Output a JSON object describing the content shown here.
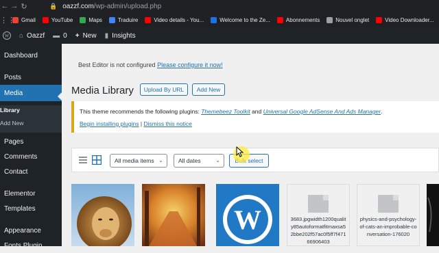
{
  "browser": {
    "url_host": "oazzf.com",
    "url_path": "/wp-admin/upload.php",
    "bookmarks": [
      {
        "label": "Gmail",
        "color": "#ea4335"
      },
      {
        "label": "YouTube",
        "color": "#ff0000"
      },
      {
        "label": "Maps",
        "color": "#34a853"
      },
      {
        "label": "Traduire",
        "color": "#4285f4"
      },
      {
        "label": "Video details - You...",
        "color": "#ff0000"
      },
      {
        "label": "Welcome to the Ze...",
        "color": "#1a73e8"
      },
      {
        "label": "Abonnements",
        "color": "#ff0000"
      },
      {
        "label": "Nouvel onglet",
        "color": "#9aa0a6"
      },
      {
        "label": "Video Downloader...",
        "color": "#ff0000"
      }
    ]
  },
  "adminbar": {
    "site_name": "Oazzf",
    "comments_count": "0",
    "new_label": "New",
    "insights_label": "Insights"
  },
  "sidebar": {
    "items": [
      {
        "label": "Dashboard"
      },
      {
        "label": "Posts"
      },
      {
        "label": "Media"
      },
      {
        "label": "Pages"
      },
      {
        "label": "Comments"
      },
      {
        "label": "Contact"
      },
      {
        "label": "Elementor"
      },
      {
        "label": "Templates"
      },
      {
        "label": "Appearance"
      },
      {
        "label": "Fonts Plugin"
      }
    ],
    "submenu": [
      {
        "label": "Library"
      },
      {
        "label": "Add New"
      }
    ]
  },
  "main": {
    "best_editor_text": "Best Editor is not configured",
    "best_editor_link": "Please configure it now!",
    "title": "Media Library",
    "upload_by_url": "Upload By URL",
    "add_new": "Add New",
    "notice": {
      "prefix": "This theme recommends the following plugins:",
      "plugin1": "Themebeez Toolkit",
      "and": "and",
      "plugin2": "Universal Google AdSense And Ads Manager",
      "suffix": ".",
      "begin_link": "Begin installing plugins",
      "separator": "|",
      "dismiss_link": "Dismiss this notice"
    },
    "toolbar": {
      "media_filter": "All media items",
      "date_filter": "All dates",
      "bulk_select": "Bulk select"
    },
    "items": [
      {
        "type": "image",
        "name": "lion"
      },
      {
        "type": "image",
        "name": "autumn-path"
      },
      {
        "type": "image",
        "name": "wordpress-logo"
      },
      {
        "type": "document",
        "name": "3683.jpgwidth1200quality85autoformatfitmaxsa52bbe202f57ac0f5ff7f47166906403"
      },
      {
        "type": "document",
        "name": "physics-and-psychology-of-cats-an-improbable-conversation-176020"
      },
      {
        "type": "image",
        "name": "dark-image"
      }
    ]
  },
  "colors": {
    "accent": "#2271b1",
    "admin_dark": "#1d2327",
    "notice_border": "#dba617"
  }
}
